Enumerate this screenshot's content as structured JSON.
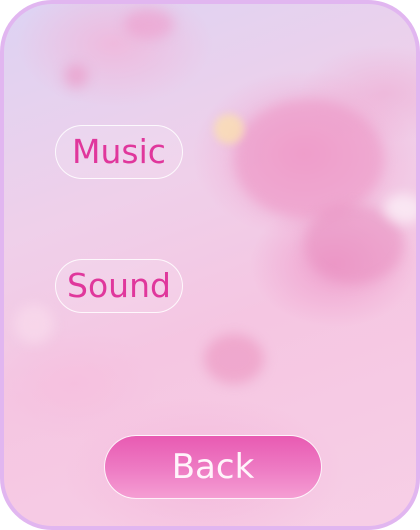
{
  "menu": {
    "options": [
      {
        "label": "Music"
      },
      {
        "label": "Sound"
      }
    ],
    "back_label": "Back"
  },
  "colors": {
    "frame": "#e1b6f0",
    "option_text": "#e0379c",
    "back_button": "#ec6dbb"
  }
}
